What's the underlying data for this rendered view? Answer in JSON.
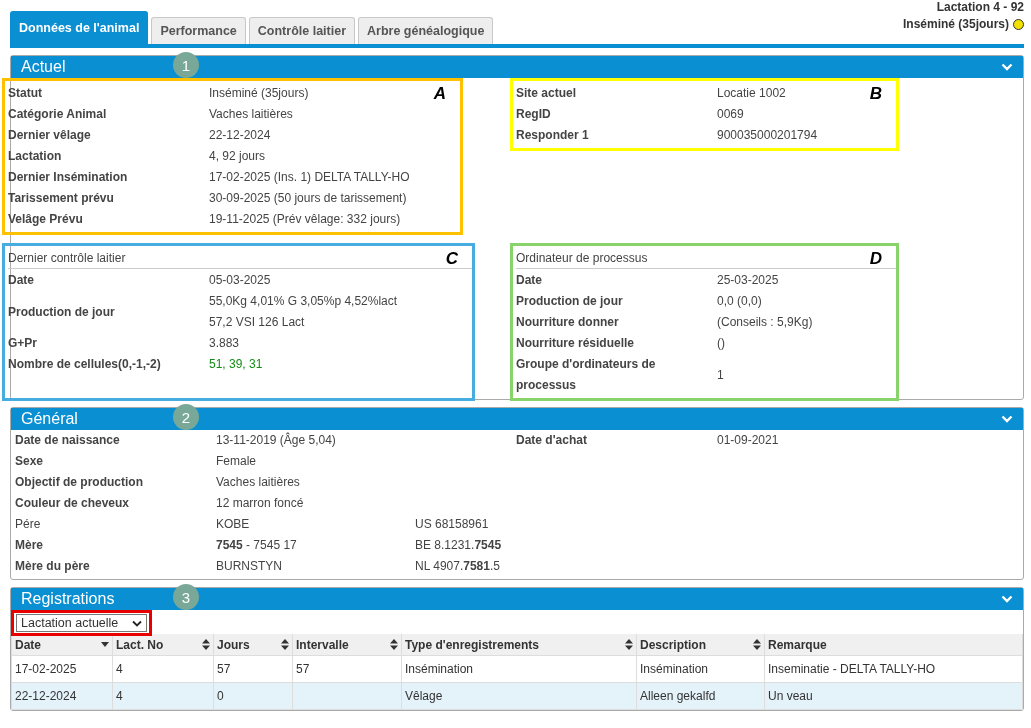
{
  "header": {
    "lactation": "Lactation 4 - 92",
    "status": "Inséminé (35jours)"
  },
  "tabs": [
    {
      "label": "Données de l'animal",
      "selected": true
    },
    {
      "label": "Performance",
      "selected": false
    },
    {
      "label": "Contrôle laitier",
      "selected": false
    },
    {
      "label": "Arbre généalogique",
      "selected": false
    }
  ],
  "actuel": {
    "title": "Actuel",
    "badge": "1",
    "blocks": [
      {
        "marker": "A",
        "color": "#ffc000",
        "rows": [
          {
            "label": "Statut",
            "value": [
              "Inséminé (35jours)"
            ]
          },
          {
            "label": "Catégorie Animal",
            "value": [
              "Vaches laitières"
            ]
          },
          {
            "label": "Dernier vêlage",
            "value": [
              "22-12-2024"
            ]
          },
          {
            "label": "Lactation",
            "value": [
              "4, 92 jours"
            ]
          },
          {
            "label": "Dernier Insémination",
            "value": [
              "17-02-2025 (Ins. 1) DELTA TALLY-HO"
            ]
          },
          {
            "label": "Tarissement prévu",
            "value": [
              "30-09-2025 (50 jours de tarissement)"
            ]
          },
          {
            "label": "Velâge Prévu",
            "value": [
              "19-11-2025 (Prév vêlage: 332 jours)"
            ]
          }
        ]
      },
      {
        "marker": "B",
        "color": "#ffff00",
        "rows": [
          {
            "label": "Site actuel",
            "value": [
              "Locatie 1002"
            ]
          },
          {
            "label": "RegID",
            "value": [
              "0069"
            ]
          },
          {
            "label": "Responder 1",
            "value": [
              "900035000201794"
            ]
          }
        ]
      },
      {
        "marker": "C",
        "color": "#47ade0",
        "title": "Dernier contrôle laitier",
        "rows": [
          {
            "label": "Date",
            "value": [
              "05-03-2025"
            ]
          },
          {
            "label": "Production de jour",
            "value": [
              "55,0Kg 4,01% G 3,05%p 4,52%lact",
              "57,2 VSI 126 Lact"
            ]
          },
          {
            "label": "G+Pr",
            "value": [
              "3.883"
            ]
          },
          {
            "label": "Nombre de cellules(0,-1,-2)",
            "value": [
              "51, 39, 31"
            ],
            "good": true
          }
        ]
      },
      {
        "marker": "D",
        "color": "#88d46a",
        "title": "Ordinateur de processus",
        "rows": [
          {
            "label": "Date",
            "value": [
              "25-03-2025"
            ]
          },
          {
            "label": "Production de jour",
            "value": [
              "0,0 (0,0)"
            ]
          },
          {
            "label": "Nourriture donner",
            "value": [
              "(Conseils : 5,9Kg)"
            ]
          },
          {
            "label": "Nourriture résiduelle",
            "value": [
              "()"
            ]
          },
          {
            "label": "Groupe d'ordinateurs de processus",
            "value": [
              "1"
            ]
          }
        ]
      }
    ]
  },
  "general": {
    "title": "Général",
    "badge": "2",
    "rows": [
      {
        "label": "Date de naissance",
        "bold": true,
        "value": "13-11-2019 (Âge 5,04)",
        "right_label": "Date d'achat",
        "right_value": "01-09-2021"
      },
      {
        "label": "Sexe",
        "bold": true,
        "value": "Female"
      },
      {
        "label": "Objectif de production",
        "bold": true,
        "value": "Vaches laitières"
      },
      {
        "label": "Couleur de cheveux",
        "bold": true,
        "value": "12 marron foncé"
      },
      {
        "label": "Pére",
        "bold": false,
        "value": "KOBE",
        "extra": "US 68158961"
      },
      {
        "label": "Mère",
        "bold": true,
        "value": "**7545** - 7545 17",
        "extra": "BE 8.1231.**7545**"
      },
      {
        "label": "Mère du père",
        "bold": true,
        "value": "BURNSTYN",
        "extra": "NL 4907.**7581**.5"
      }
    ]
  },
  "registrations": {
    "title": "Registrations",
    "badge": "3",
    "filter": {
      "value": "Lactation actuelle",
      "annotated": true
    },
    "columns": [
      {
        "label": "Date",
        "kind": "desc"
      },
      {
        "label": "Lact. No",
        "kind": "both"
      },
      {
        "label": "Jours",
        "kind": "both"
      },
      {
        "label": "Intervalle",
        "kind": "both"
      },
      {
        "label": "Type d'enregistrements",
        "kind": "both"
      },
      {
        "label": "Description",
        "kind": "both"
      },
      {
        "label": "Remarque",
        "kind": "none"
      }
    ],
    "rows": [
      {
        "highlighted": false,
        "cells": [
          "17-02-2025",
          "4",
          "57",
          "57",
          "Insémination",
          "Insémination",
          "Inseminatie - DELTA TALLY-HO"
        ]
      },
      {
        "highlighted": true,
        "cells": [
          "22-12-2024",
          "4",
          "0",
          "",
          "Vêlage",
          "Alleen gekalfd",
          "Un veau"
        ]
      }
    ]
  }
}
